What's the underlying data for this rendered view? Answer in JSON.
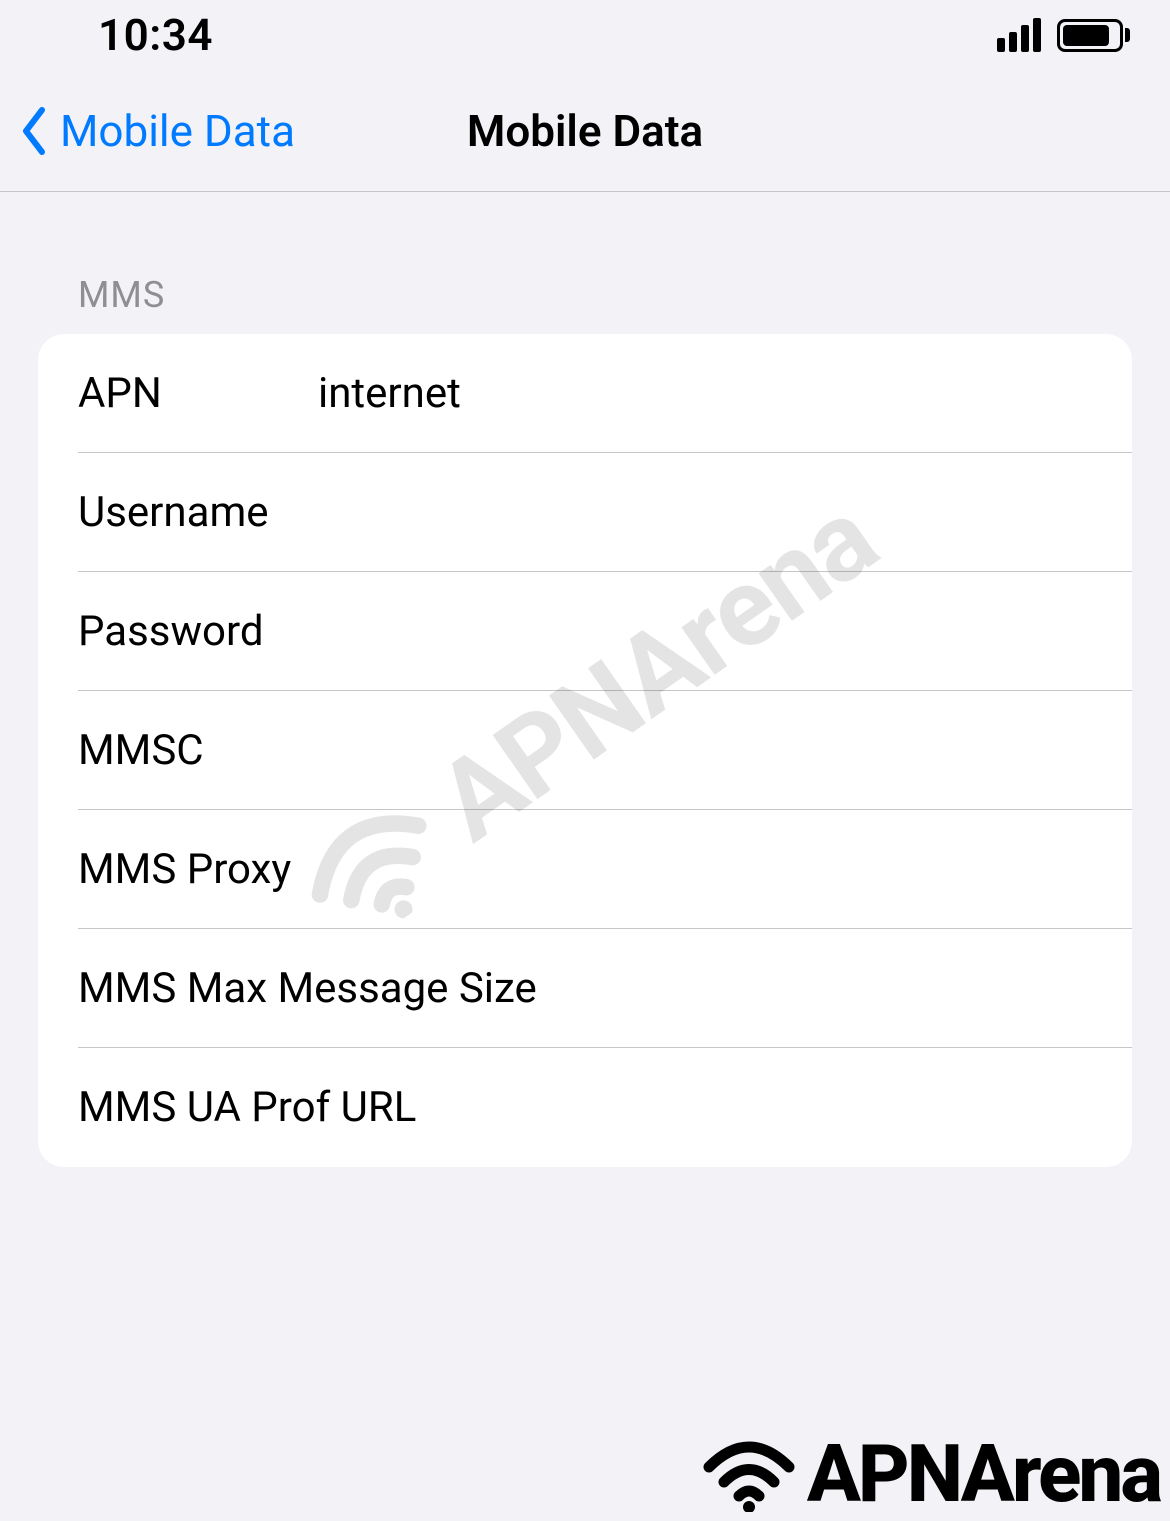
{
  "status_bar": {
    "time": "10:34"
  },
  "nav": {
    "back_label": "Mobile Data",
    "title": "Mobile Data"
  },
  "section": {
    "header": "MMS",
    "fields": {
      "apn": {
        "label": "APN",
        "value": "internet"
      },
      "username": {
        "label": "Username",
        "value": ""
      },
      "password": {
        "label": "Password",
        "value": ""
      },
      "mmsc": {
        "label": "MMSC",
        "value": ""
      },
      "mms_proxy": {
        "label": "MMS Proxy",
        "value": ""
      },
      "mms_max_size": {
        "label": "MMS Max Message Size",
        "value": ""
      },
      "mms_ua_prof": {
        "label": "MMS UA Prof URL",
        "value": ""
      }
    }
  },
  "watermark": {
    "text": "APNArena"
  },
  "footer_logo": {
    "text": "APNArena"
  }
}
